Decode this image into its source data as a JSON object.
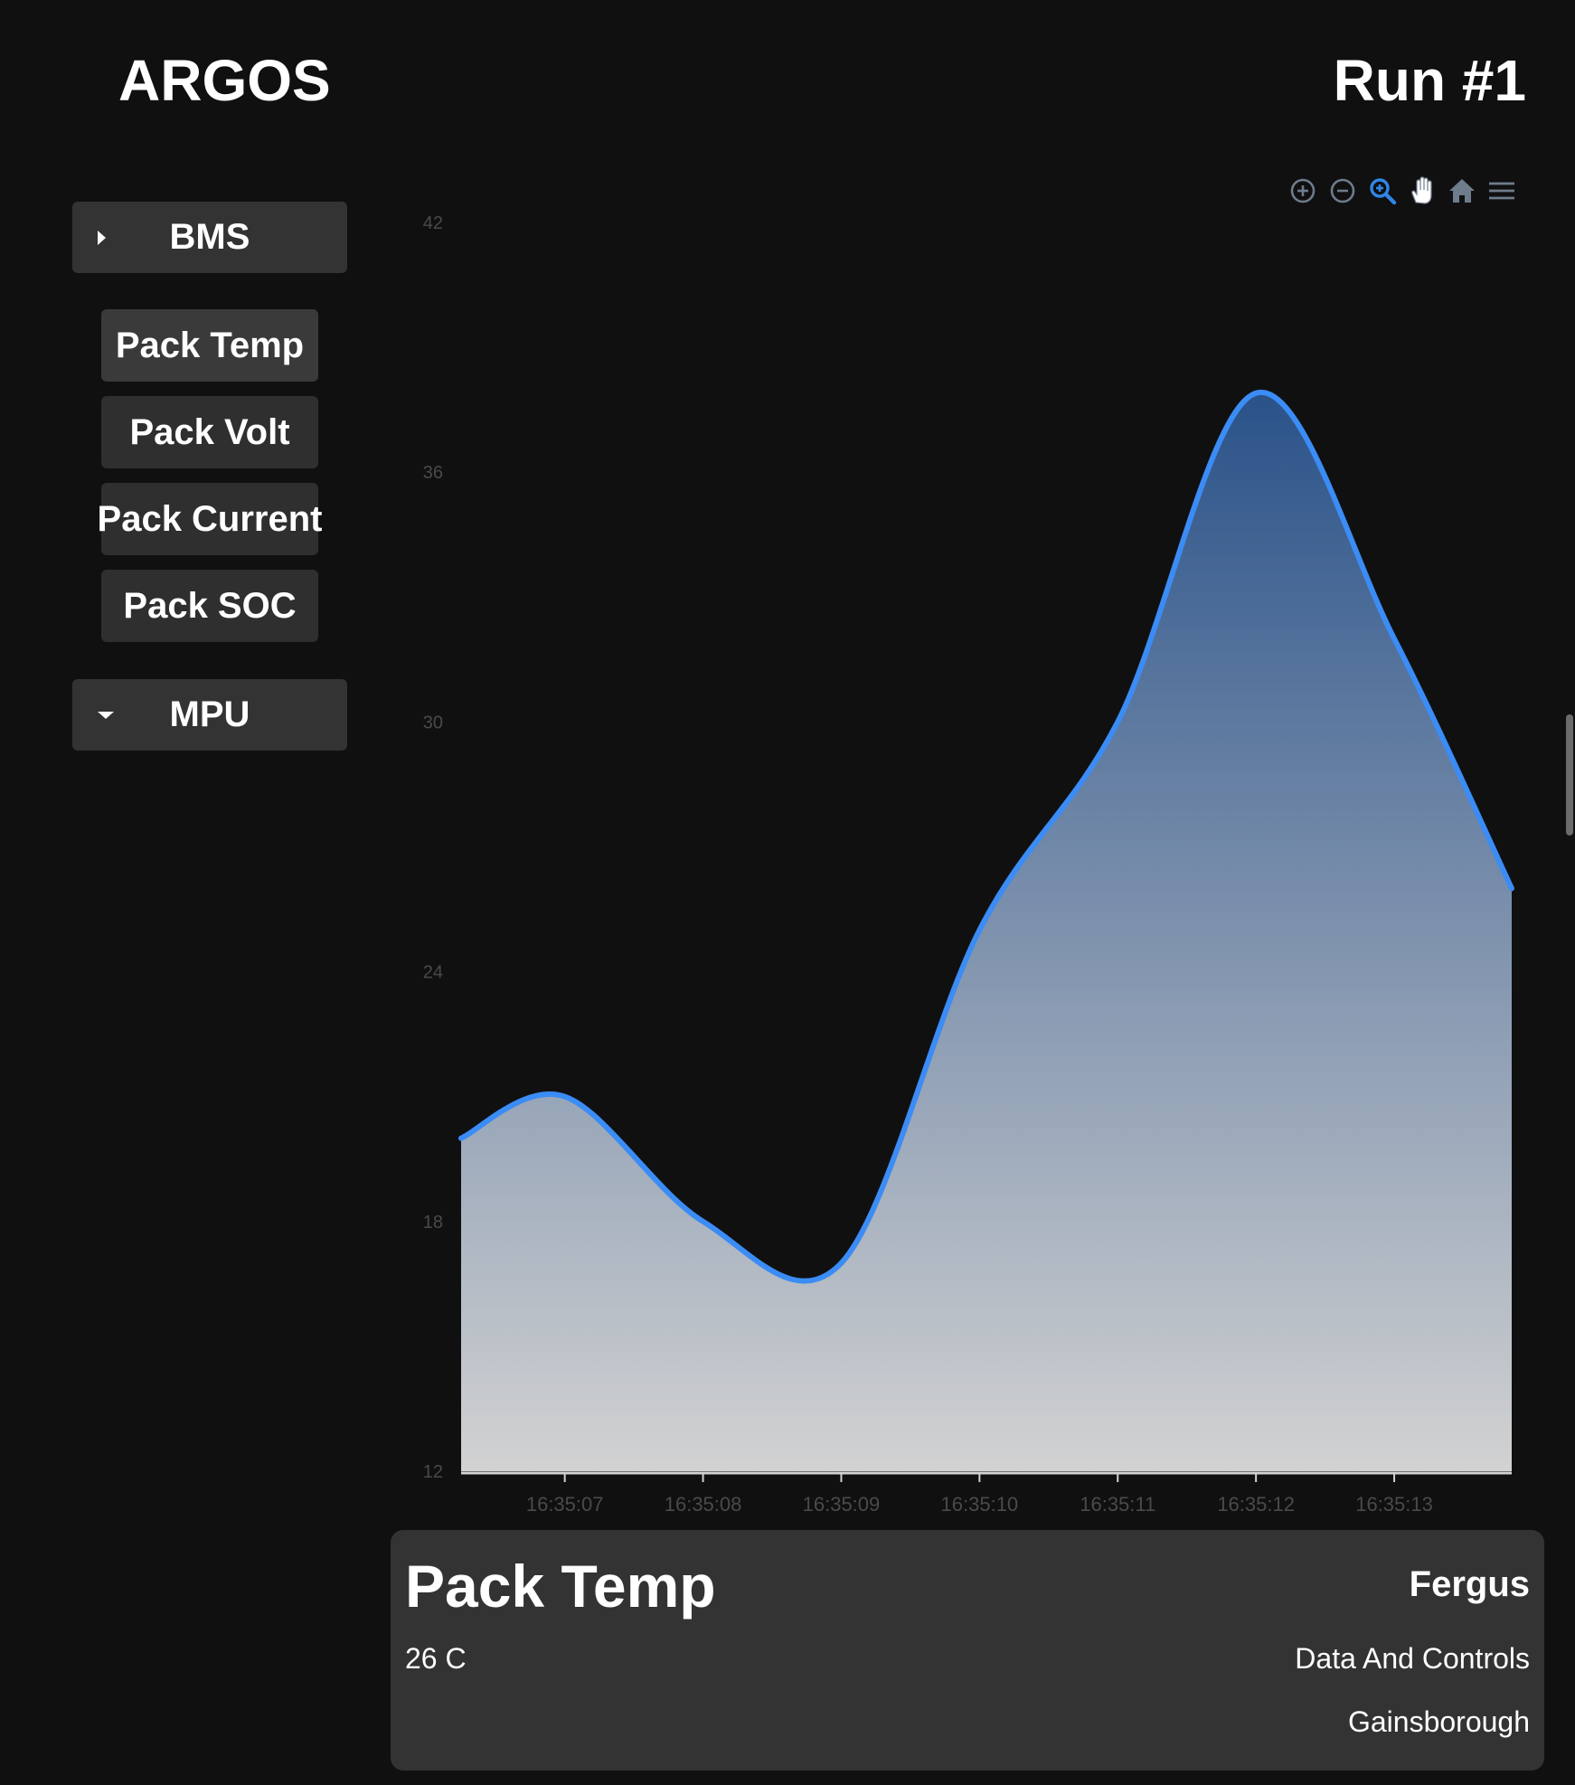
{
  "header": {
    "app_title": "ARGOS",
    "run_title": "Run #1"
  },
  "sidebar": {
    "groups": [
      {
        "label": "BMS",
        "expanded": false,
        "caret_icon": "caret-right-icon"
      },
      {
        "label": "MPU",
        "expanded": true,
        "caret_icon": "caret-down-icon"
      }
    ],
    "items": [
      {
        "label": "Pack Temp",
        "active": true
      },
      {
        "label": "Pack Volt",
        "active": false
      },
      {
        "label": "Pack Current",
        "active": false
      },
      {
        "label": "Pack SOC",
        "active": false
      }
    ]
  },
  "toolbar": {
    "icons": [
      "zoom-in-icon",
      "zoom-out-icon",
      "selection-zoom-icon",
      "pan-hand-icon",
      "reset-home-icon",
      "menu-icon"
    ],
    "active_icon": "selection-zoom-icon",
    "active_color": "#2f86e8",
    "inactive_color": "#6e7c8c"
  },
  "chart_data": {
    "type": "area",
    "title": "",
    "xlabel": "",
    "ylabel": "",
    "y_ticks": [
      12,
      18,
      24,
      30,
      36,
      42
    ],
    "ylim": [
      12,
      42
    ],
    "x_ticks": [
      "16:35:07",
      "16:35:08",
      "16:35:09",
      "16:35:10",
      "16:35:11",
      "16:35:12",
      "16:35:13"
    ],
    "xlim": [
      "16:35:06.25",
      "16:35:13.85"
    ],
    "series": [
      {
        "x": [
          "16:35:06.25",
          "16:35:07",
          "16:35:08",
          "16:35:09",
          "16:35:10",
          "16:35:11",
          "16:35:12",
          "16:35:13",
          "16:35:13.85"
        ],
        "values": [
          20,
          21,
          18,
          17,
          25,
          30,
          37.9,
          32,
          26
        ],
        "color": "#3b8cf5"
      }
    ],
    "fill_gradient": [
      "#2a5289",
      "#d2d2d2"
    ],
    "grid": false
  },
  "info_card": {
    "title": "Pack Temp",
    "value": "26 C",
    "name": "Fergus",
    "team": "Data And Controls",
    "house": "Gainsborough"
  }
}
